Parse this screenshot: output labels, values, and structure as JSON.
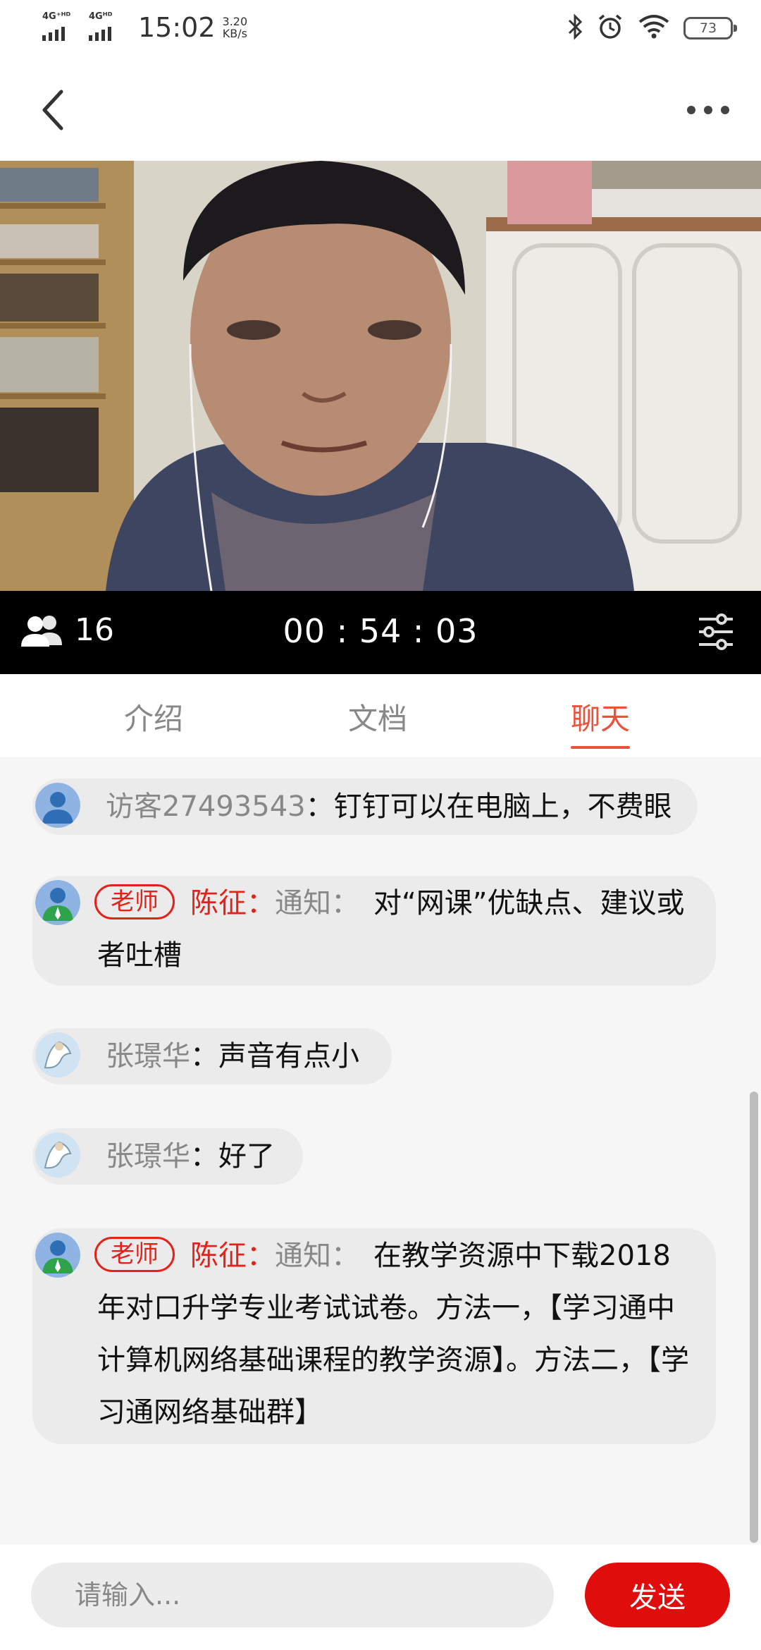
{
  "status_bar": {
    "signal1_label": "4G⁺ᴴᴰ",
    "signal2_label": "4Gᴴᴰ",
    "time": "15:02",
    "speed_value": "3.20",
    "speed_unit": "KB/s",
    "battery": "73",
    "icons": [
      "bluetooth-icon",
      "alarm-icon",
      "wifi-icon",
      "battery-icon"
    ]
  },
  "header": {
    "back_icon": "chevron-left-icon",
    "more_icon": "more-dots-icon"
  },
  "live": {
    "viewer_count": "16",
    "elapsed": "00 : 54 : 03",
    "settings_icon": "sliders-icon"
  },
  "tabs": [
    {
      "label": "介绍",
      "active": false
    },
    {
      "label": "文档",
      "active": false
    },
    {
      "label": "聊天",
      "active": true
    }
  ],
  "messages": [
    {
      "sender": "访客27493543",
      "sep": "：",
      "text": "钉钉可以在电脑上，不费眼"
    },
    {
      "badge": "老师",
      "sender": "陈征",
      "sep": "：",
      "notice": "通知：",
      "text": "对“网课”优缺点、建议或者吐槽"
    },
    {
      "sender": "张璟华",
      "sep": "：",
      "text": "声音有点小"
    },
    {
      "sender": "张璟华",
      "sep": "：",
      "text": "好了"
    },
    {
      "badge": "老师",
      "sender": "陈征",
      "sep": "：",
      "notice": "通知：",
      "text": "在教学资源中下载2018年对口升学专业考试试卷。方法一，【学习通中计算机网络基础课程的教学资源】。方法二，【学习通网络基础群】"
    }
  ],
  "input": {
    "placeholder": "请输入...",
    "send_label": "发送"
  },
  "colors": {
    "accent": "#e9533b",
    "teacher_red": "#e2231a",
    "send_button": "#e00d0d"
  }
}
